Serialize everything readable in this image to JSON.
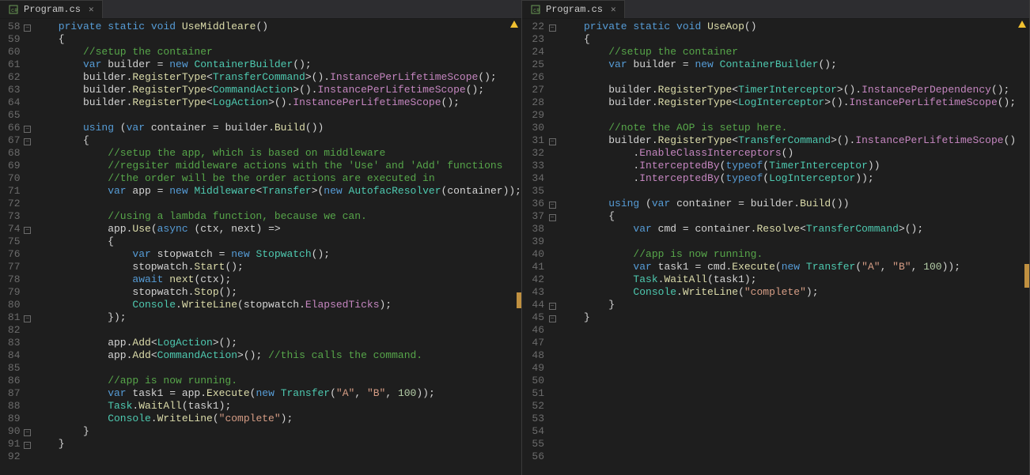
{
  "tabs": {
    "left": "Program.cs",
    "right": "Program.cs"
  },
  "left": {
    "startLine": 58,
    "folds": {
      "58": "-",
      "66": "-",
      "67": "-",
      "74": "-",
      "81": "-",
      "90": "-",
      "91": "-"
    },
    "lines": [
      [
        [
          "kw",
          "private"
        ],
        [
          "punc",
          " "
        ],
        [
          "kw",
          "static"
        ],
        [
          "punc",
          " "
        ],
        [
          "kw",
          "void"
        ],
        [
          "punc",
          " "
        ],
        [
          "fn",
          "UseMiddleare"
        ],
        [
          "punc",
          "()"
        ]
      ],
      [
        [
          "punc",
          "{"
        ]
      ],
      [
        [
          "punc",
          "    "
        ],
        [
          "cmt",
          "//setup the container"
        ]
      ],
      [
        [
          "punc",
          "    "
        ],
        [
          "kw",
          "var"
        ],
        [
          "punc",
          " "
        ],
        [
          "ident",
          "builder"
        ],
        [
          "punc",
          " = "
        ],
        [
          "kw",
          "new"
        ],
        [
          "punc",
          " "
        ],
        [
          "type",
          "ContainerBuilder"
        ],
        [
          "punc",
          "();"
        ]
      ],
      [
        [
          "punc",
          "    "
        ],
        [
          "ident",
          "builder"
        ],
        [
          "punc",
          "."
        ],
        [
          "fn",
          "RegisterType"
        ],
        [
          "punc",
          "<"
        ],
        [
          "type",
          "TransferCommand"
        ],
        [
          "punc",
          ">()."
        ],
        [
          "method",
          "InstancePerLifetimeScope"
        ],
        [
          "punc",
          "();"
        ]
      ],
      [
        [
          "punc",
          "    "
        ],
        [
          "ident",
          "builder"
        ],
        [
          "punc",
          "."
        ],
        [
          "fn",
          "RegisterType"
        ],
        [
          "punc",
          "<"
        ],
        [
          "type",
          "CommandAction"
        ],
        [
          "punc",
          ">()."
        ],
        [
          "method",
          "InstancePerLifetimeScope"
        ],
        [
          "punc",
          "();"
        ]
      ],
      [
        [
          "punc",
          "    "
        ],
        [
          "ident",
          "builder"
        ],
        [
          "punc",
          "."
        ],
        [
          "fn",
          "RegisterType"
        ],
        [
          "punc",
          "<"
        ],
        [
          "type",
          "LogAction"
        ],
        [
          "punc",
          ">()."
        ],
        [
          "method",
          "InstancePerLifetimeScope"
        ],
        [
          "punc",
          "();"
        ]
      ],
      [],
      [
        [
          "punc",
          "    "
        ],
        [
          "kw",
          "using"
        ],
        [
          "punc",
          " ("
        ],
        [
          "kw",
          "var"
        ],
        [
          "punc",
          " "
        ],
        [
          "ident",
          "container"
        ],
        [
          "punc",
          " = "
        ],
        [
          "ident",
          "builder"
        ],
        [
          "punc",
          "."
        ],
        [
          "fn",
          "Build"
        ],
        [
          "punc",
          "())"
        ]
      ],
      [
        [
          "punc",
          "    {"
        ]
      ],
      [
        [
          "punc",
          "        "
        ],
        [
          "cmt",
          "//setup the app, which is based on middleware"
        ]
      ],
      [
        [
          "punc",
          "        "
        ],
        [
          "cmt",
          "//regsiter middleware actions with the 'Use' and 'Add' functions"
        ]
      ],
      [
        [
          "punc",
          "        "
        ],
        [
          "cmt",
          "//the order will be the order actions are executed in"
        ]
      ],
      [
        [
          "punc",
          "        "
        ],
        [
          "kw",
          "var"
        ],
        [
          "punc",
          " "
        ],
        [
          "ident",
          "app"
        ],
        [
          "punc",
          " = "
        ],
        [
          "kw",
          "new"
        ],
        [
          "punc",
          " "
        ],
        [
          "type",
          "Middleware"
        ],
        [
          "punc",
          "<"
        ],
        [
          "type",
          "Transfer"
        ],
        [
          "punc",
          ">("
        ],
        [
          "kw",
          "new"
        ],
        [
          "punc",
          " "
        ],
        [
          "type",
          "AutofacResolver"
        ],
        [
          "punc",
          "("
        ],
        [
          "ident",
          "container"
        ],
        [
          "punc",
          "));"
        ]
      ],
      [],
      [
        [
          "punc",
          "        "
        ],
        [
          "cmt",
          "//using a lambda function, because we can."
        ]
      ],
      [
        [
          "punc",
          "        "
        ],
        [
          "ident",
          "app"
        ],
        [
          "punc",
          "."
        ],
        [
          "fn",
          "Use"
        ],
        [
          "punc",
          "("
        ],
        [
          "kw",
          "async"
        ],
        [
          "punc",
          " ("
        ],
        [
          "ident",
          "ctx"
        ],
        [
          "punc",
          ", "
        ],
        [
          "ident",
          "next"
        ],
        [
          "punc",
          ") =>"
        ]
      ],
      [
        [
          "punc",
          "        {"
        ]
      ],
      [
        [
          "punc",
          "            "
        ],
        [
          "kw",
          "var"
        ],
        [
          "punc",
          " "
        ],
        [
          "ident",
          "stopwatch"
        ],
        [
          "punc",
          " = "
        ],
        [
          "kw",
          "new"
        ],
        [
          "punc",
          " "
        ],
        [
          "type",
          "Stopwatch"
        ],
        [
          "punc",
          "();"
        ]
      ],
      [
        [
          "punc",
          "            "
        ],
        [
          "ident",
          "stopwatch"
        ],
        [
          "punc",
          "."
        ],
        [
          "fn",
          "Start"
        ],
        [
          "punc",
          "();"
        ]
      ],
      [
        [
          "punc",
          "            "
        ],
        [
          "kw",
          "await"
        ],
        [
          "punc",
          " "
        ],
        [
          "fn",
          "next"
        ],
        [
          "punc",
          "("
        ],
        [
          "ident",
          "ctx"
        ],
        [
          "punc",
          ");"
        ]
      ],
      [
        [
          "punc",
          "            "
        ],
        [
          "ident",
          "stopwatch"
        ],
        [
          "punc",
          "."
        ],
        [
          "fn",
          "Stop"
        ],
        [
          "punc",
          "();"
        ]
      ],
      [
        [
          "punc",
          "            "
        ],
        [
          "type",
          "Console"
        ],
        [
          "punc",
          "."
        ],
        [
          "fn",
          "WriteLine"
        ],
        [
          "punc",
          "("
        ],
        [
          "ident",
          "stopwatch"
        ],
        [
          "punc",
          "."
        ],
        [
          "method",
          "ElapsedTicks"
        ],
        [
          "punc",
          ");"
        ]
      ],
      [
        [
          "punc",
          "        });"
        ]
      ],
      [],
      [
        [
          "punc",
          "        "
        ],
        [
          "ident",
          "app"
        ],
        [
          "punc",
          "."
        ],
        [
          "fn",
          "Add"
        ],
        [
          "punc",
          "<"
        ],
        [
          "type",
          "LogAction"
        ],
        [
          "punc",
          ">();"
        ]
      ],
      [
        [
          "punc",
          "        "
        ],
        [
          "ident",
          "app"
        ],
        [
          "punc",
          "."
        ],
        [
          "fn",
          "Add"
        ],
        [
          "punc",
          "<"
        ],
        [
          "type",
          "CommandAction"
        ],
        [
          "punc",
          ">(); "
        ],
        [
          "cmt",
          "//this calls the command."
        ]
      ],
      [],
      [
        [
          "punc",
          "        "
        ],
        [
          "cmt",
          "//app is now running."
        ]
      ],
      [
        [
          "punc",
          "        "
        ],
        [
          "kw",
          "var"
        ],
        [
          "punc",
          " "
        ],
        [
          "ident",
          "task1"
        ],
        [
          "punc",
          " = "
        ],
        [
          "ident",
          "app"
        ],
        [
          "punc",
          "."
        ],
        [
          "fn",
          "Execute"
        ],
        [
          "punc",
          "("
        ],
        [
          "kw",
          "new"
        ],
        [
          "punc",
          " "
        ],
        [
          "type",
          "Transfer"
        ],
        [
          "punc",
          "("
        ],
        [
          "str",
          "\"A\""
        ],
        [
          "punc",
          ", "
        ],
        [
          "str",
          "\"B\""
        ],
        [
          "punc",
          ", "
        ],
        [
          "num",
          "100"
        ],
        [
          "punc",
          "));"
        ]
      ],
      [
        [
          "punc",
          "        "
        ],
        [
          "type",
          "Task"
        ],
        [
          "punc",
          "."
        ],
        [
          "fn",
          "WaitAll"
        ],
        [
          "punc",
          "("
        ],
        [
          "ident",
          "task1"
        ],
        [
          "punc",
          ");"
        ]
      ],
      [
        [
          "punc",
          "        "
        ],
        [
          "type",
          "Console"
        ],
        [
          "punc",
          "."
        ],
        [
          "fn",
          "WriteLine"
        ],
        [
          "punc",
          "("
        ],
        [
          "str",
          "\"complete\""
        ],
        [
          "punc",
          ");"
        ]
      ],
      [
        [
          "punc",
          "    }"
        ]
      ],
      [
        [
          "punc",
          "}"
        ]
      ],
      []
    ]
  },
  "right": {
    "startLine": 22,
    "folds": {
      "22": "-",
      "31": "-",
      "36": "-",
      "37": "-",
      "44": "-",
      "45": "-"
    },
    "lines": [
      [
        [
          "kw",
          "private"
        ],
        [
          "punc",
          " "
        ],
        [
          "kw",
          "static"
        ],
        [
          "punc",
          " "
        ],
        [
          "kw",
          "void"
        ],
        [
          "punc",
          " "
        ],
        [
          "fn",
          "UseAop"
        ],
        [
          "punc",
          "()"
        ]
      ],
      [
        [
          "punc",
          "{"
        ]
      ],
      [
        [
          "punc",
          "    "
        ],
        [
          "cmt",
          "//setup the container"
        ]
      ],
      [
        [
          "punc",
          "    "
        ],
        [
          "kw",
          "var"
        ],
        [
          "punc",
          " "
        ],
        [
          "ident",
          "builder"
        ],
        [
          "punc",
          " = "
        ],
        [
          "kw",
          "new"
        ],
        [
          "punc",
          " "
        ],
        [
          "type",
          "ContainerBuilder"
        ],
        [
          "punc",
          "();"
        ]
      ],
      [],
      [
        [
          "punc",
          "    "
        ],
        [
          "ident",
          "builder"
        ],
        [
          "punc",
          "."
        ],
        [
          "fn",
          "RegisterType"
        ],
        [
          "punc",
          "<"
        ],
        [
          "type",
          "TimerInterceptor"
        ],
        [
          "punc",
          ">()."
        ],
        [
          "method",
          "InstancePerDependency"
        ],
        [
          "punc",
          "();"
        ]
      ],
      [
        [
          "punc",
          "    "
        ],
        [
          "ident",
          "builder"
        ],
        [
          "punc",
          "."
        ],
        [
          "fn",
          "RegisterType"
        ],
        [
          "punc",
          "<"
        ],
        [
          "type",
          "LogInterceptor"
        ],
        [
          "punc",
          ">()."
        ],
        [
          "method",
          "InstancePerLifetimeScope"
        ],
        [
          "punc",
          "();"
        ]
      ],
      [],
      [
        [
          "punc",
          "    "
        ],
        [
          "cmt",
          "//note the AOP is setup here."
        ]
      ],
      [
        [
          "punc",
          "    "
        ],
        [
          "ident",
          "builder"
        ],
        [
          "punc",
          "."
        ],
        [
          "fn",
          "RegisterType"
        ],
        [
          "punc",
          "<"
        ],
        [
          "type",
          "TransferCommand"
        ],
        [
          "punc",
          ">()."
        ],
        [
          "method",
          "InstancePerLifetimeScope"
        ],
        [
          "punc",
          "()"
        ]
      ],
      [
        [
          "punc",
          "        ."
        ],
        [
          "method",
          "EnableClassInterceptors"
        ],
        [
          "punc",
          "()"
        ]
      ],
      [
        [
          "punc",
          "        ."
        ],
        [
          "method",
          "InterceptedBy"
        ],
        [
          "punc",
          "("
        ],
        [
          "kw",
          "typeof"
        ],
        [
          "punc",
          "("
        ],
        [
          "type",
          "TimerInterceptor"
        ],
        [
          "punc",
          "))"
        ]
      ],
      [
        [
          "punc",
          "        ."
        ],
        [
          "method",
          "InterceptedBy"
        ],
        [
          "punc",
          "("
        ],
        [
          "kw",
          "typeof"
        ],
        [
          "punc",
          "("
        ],
        [
          "type",
          "LogInterceptor"
        ],
        [
          "punc",
          "));"
        ]
      ],
      [],
      [
        [
          "punc",
          "    "
        ],
        [
          "kw",
          "using"
        ],
        [
          "punc",
          " ("
        ],
        [
          "kw",
          "var"
        ],
        [
          "punc",
          " "
        ],
        [
          "ident",
          "container"
        ],
        [
          "punc",
          " = "
        ],
        [
          "ident",
          "builder"
        ],
        [
          "punc",
          "."
        ],
        [
          "fn",
          "Build"
        ],
        [
          "punc",
          "())"
        ]
      ],
      [
        [
          "punc",
          "    {"
        ]
      ],
      [
        [
          "punc",
          "        "
        ],
        [
          "kw",
          "var"
        ],
        [
          "punc",
          " "
        ],
        [
          "ident",
          "cmd"
        ],
        [
          "punc",
          " = "
        ],
        [
          "ident",
          "container"
        ],
        [
          "punc",
          "."
        ],
        [
          "fn",
          "Resolve"
        ],
        [
          "punc",
          "<"
        ],
        [
          "type",
          "TransferCommand"
        ],
        [
          "punc",
          ">();"
        ]
      ],
      [],
      [
        [
          "punc",
          "        "
        ],
        [
          "cmt",
          "//app is now running."
        ]
      ],
      [
        [
          "punc",
          "        "
        ],
        [
          "kw",
          "var"
        ],
        [
          "punc",
          " "
        ],
        [
          "ident",
          "task1"
        ],
        [
          "punc",
          " = "
        ],
        [
          "ident",
          "cmd"
        ],
        [
          "punc",
          "."
        ],
        [
          "fn",
          "Execute"
        ],
        [
          "punc",
          "("
        ],
        [
          "kw",
          "new"
        ],
        [
          "punc",
          " "
        ],
        [
          "type",
          "Transfer"
        ],
        [
          "punc",
          "("
        ],
        [
          "str",
          "\"A\""
        ],
        [
          "punc",
          ", "
        ],
        [
          "str",
          "\"B\""
        ],
        [
          "punc",
          ", "
        ],
        [
          "num",
          "100"
        ],
        [
          "punc",
          "));"
        ]
      ],
      [
        [
          "punc",
          "        "
        ],
        [
          "type",
          "Task"
        ],
        [
          "punc",
          "."
        ],
        [
          "fn",
          "WaitAll"
        ],
        [
          "punc",
          "("
        ],
        [
          "ident",
          "task1"
        ],
        [
          "punc",
          ");"
        ]
      ],
      [
        [
          "punc",
          "        "
        ],
        [
          "type",
          "Console"
        ],
        [
          "punc",
          "."
        ],
        [
          "fn",
          "WriteLine"
        ],
        [
          "punc",
          "("
        ],
        [
          "str",
          "\"complete\""
        ],
        [
          "punc",
          ");"
        ]
      ],
      [
        [
          "punc",
          "    }"
        ]
      ],
      [
        [
          "punc",
          "}"
        ]
      ],
      [],
      [],
      [],
      [],
      [],
      [],
      [],
      [],
      [],
      [],
      []
    ]
  }
}
